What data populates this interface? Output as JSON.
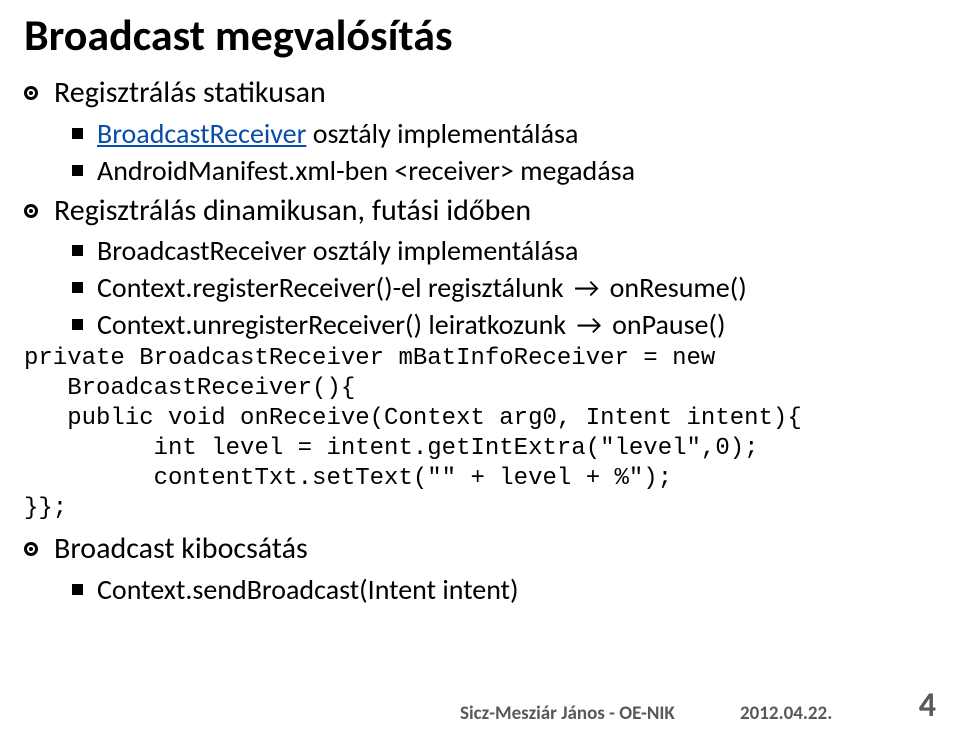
{
  "title": "Broadcast megvalósítás",
  "items": [
    {
      "level": 1,
      "text": "Regisztrálás statikusan"
    },
    {
      "level": 2,
      "link": true,
      "text": "BroadcastReceiver",
      "after": " osztály implementálása"
    },
    {
      "level": 2,
      "text": "AndroidManifest.xml-ben <receiver> megadása"
    },
    {
      "level": 1,
      "text": "Regisztrálás dinamikusan, futási időben"
    },
    {
      "level": 2,
      "text": "BroadcastReceiver osztály implementálása"
    },
    {
      "level": 2,
      "text": "Context.registerReceiver()-el regisztálunk ",
      "arrow": true,
      "after": " onResume()"
    },
    {
      "level": 2,
      "text": "Context.unregisterReceiver() leiratkozunk ",
      "arrow": true,
      "after": " onPause()"
    }
  ],
  "code": "private BroadcastReceiver mBatInfoReceiver = new\n   BroadcastReceiver(){\n   public void onReceive(Context arg0, Intent intent){\n         int level = intent.getIntExtra(\"level\",0);\n         contentTxt.setText(\"\" + level + %\");\n}};",
  "items2": [
    {
      "level": 1,
      "text": "Broadcast kibocsátás"
    },
    {
      "level": 2,
      "text": "Context.sendBroadcast(Intent intent)"
    }
  ],
  "footer": {
    "author": "Sicz-Mesziár János - OE-NIK",
    "date": "2012.04.22.",
    "page": "4"
  }
}
